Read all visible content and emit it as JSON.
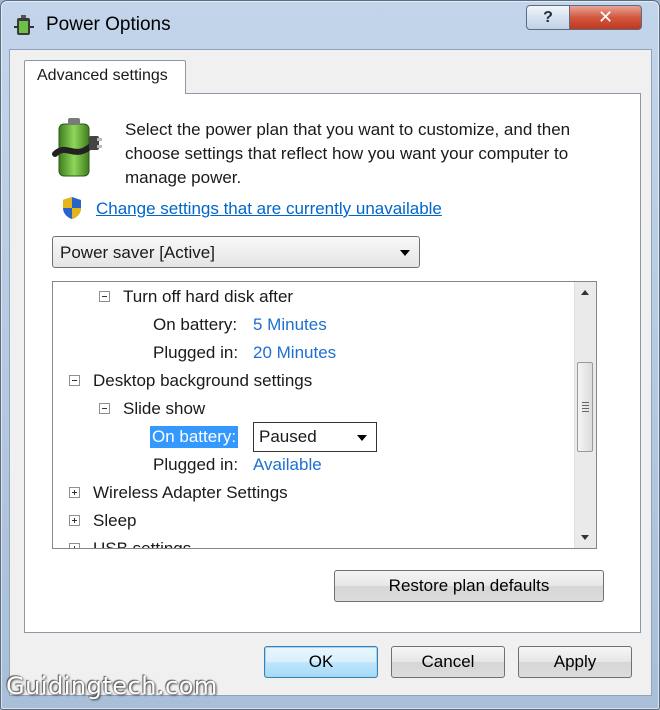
{
  "window": {
    "title": "Power Options",
    "help_label": "?",
    "close_label": "✕"
  },
  "tab": {
    "label": "Advanced settings"
  },
  "intro": {
    "description": "Select the power plan that you want to customize, and then choose settings that reflect how you want your computer to manage power.",
    "change_link": "Change settings that are currently unavailable"
  },
  "plan_select": {
    "value": "Power saver [Active]"
  },
  "tree": {
    "hard_disk": {
      "label": "Turn off hard disk after",
      "on_battery_label": "On battery:",
      "on_battery_value": "5 Minutes",
      "plugged_in_label": "Plugged in:",
      "plugged_in_value": "20 Minutes"
    },
    "desktop_bg": {
      "label": "Desktop background settings"
    },
    "slide_show": {
      "label": "Slide show",
      "on_battery_label": "On battery:",
      "on_battery_value": "Paused",
      "plugged_in_label": "Plugged in:",
      "plugged_in_value": "Available"
    },
    "wireless": {
      "label": "Wireless Adapter Settings"
    },
    "sleep": {
      "label": "Sleep"
    },
    "usb": {
      "label": "USB settings"
    }
  },
  "buttons": {
    "restore": "Restore plan defaults",
    "ok": "OK",
    "cancel": "Cancel",
    "apply": "Apply"
  },
  "watermark": "Guidingtech.com",
  "colors": {
    "link": "#0066cc",
    "value_link": "#1e6fd0",
    "selection": "#3399ff",
    "close_button": "#c1371e"
  }
}
